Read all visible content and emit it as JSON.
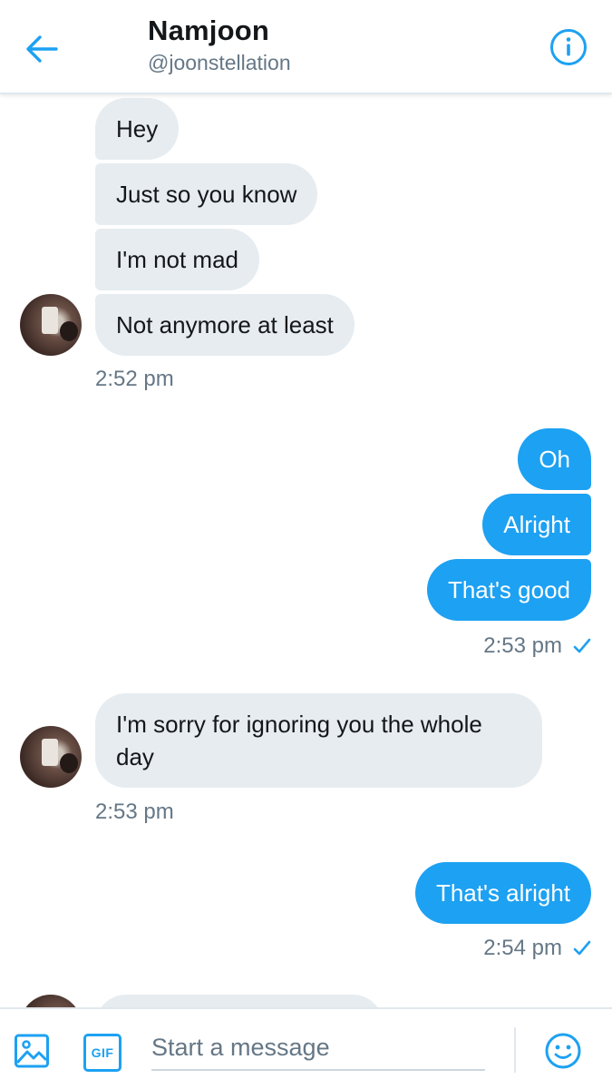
{
  "header": {
    "title": "Namjoon",
    "handle": "@joonstellation"
  },
  "messages": {
    "group1": [
      "Hey",
      "Just so you know",
      "I'm not mad",
      "Not anymore at least"
    ],
    "time1": "2:52 pm",
    "group2": [
      "Oh",
      "Alright",
      "That's good"
    ],
    "time2": "2:53 pm",
    "group3": [
      "I'm sorry for ignoring you the whole day"
    ],
    "time3": "2:53 pm",
    "group4": [
      "That's alright"
    ],
    "time4": "2:54 pm"
  },
  "composer": {
    "placeholder": "Start a message",
    "gif_label": "GIF"
  },
  "colors": {
    "accent": "#1da1f2",
    "incoming_bubble": "#e6ecf0",
    "secondary_text": "#657786"
  }
}
